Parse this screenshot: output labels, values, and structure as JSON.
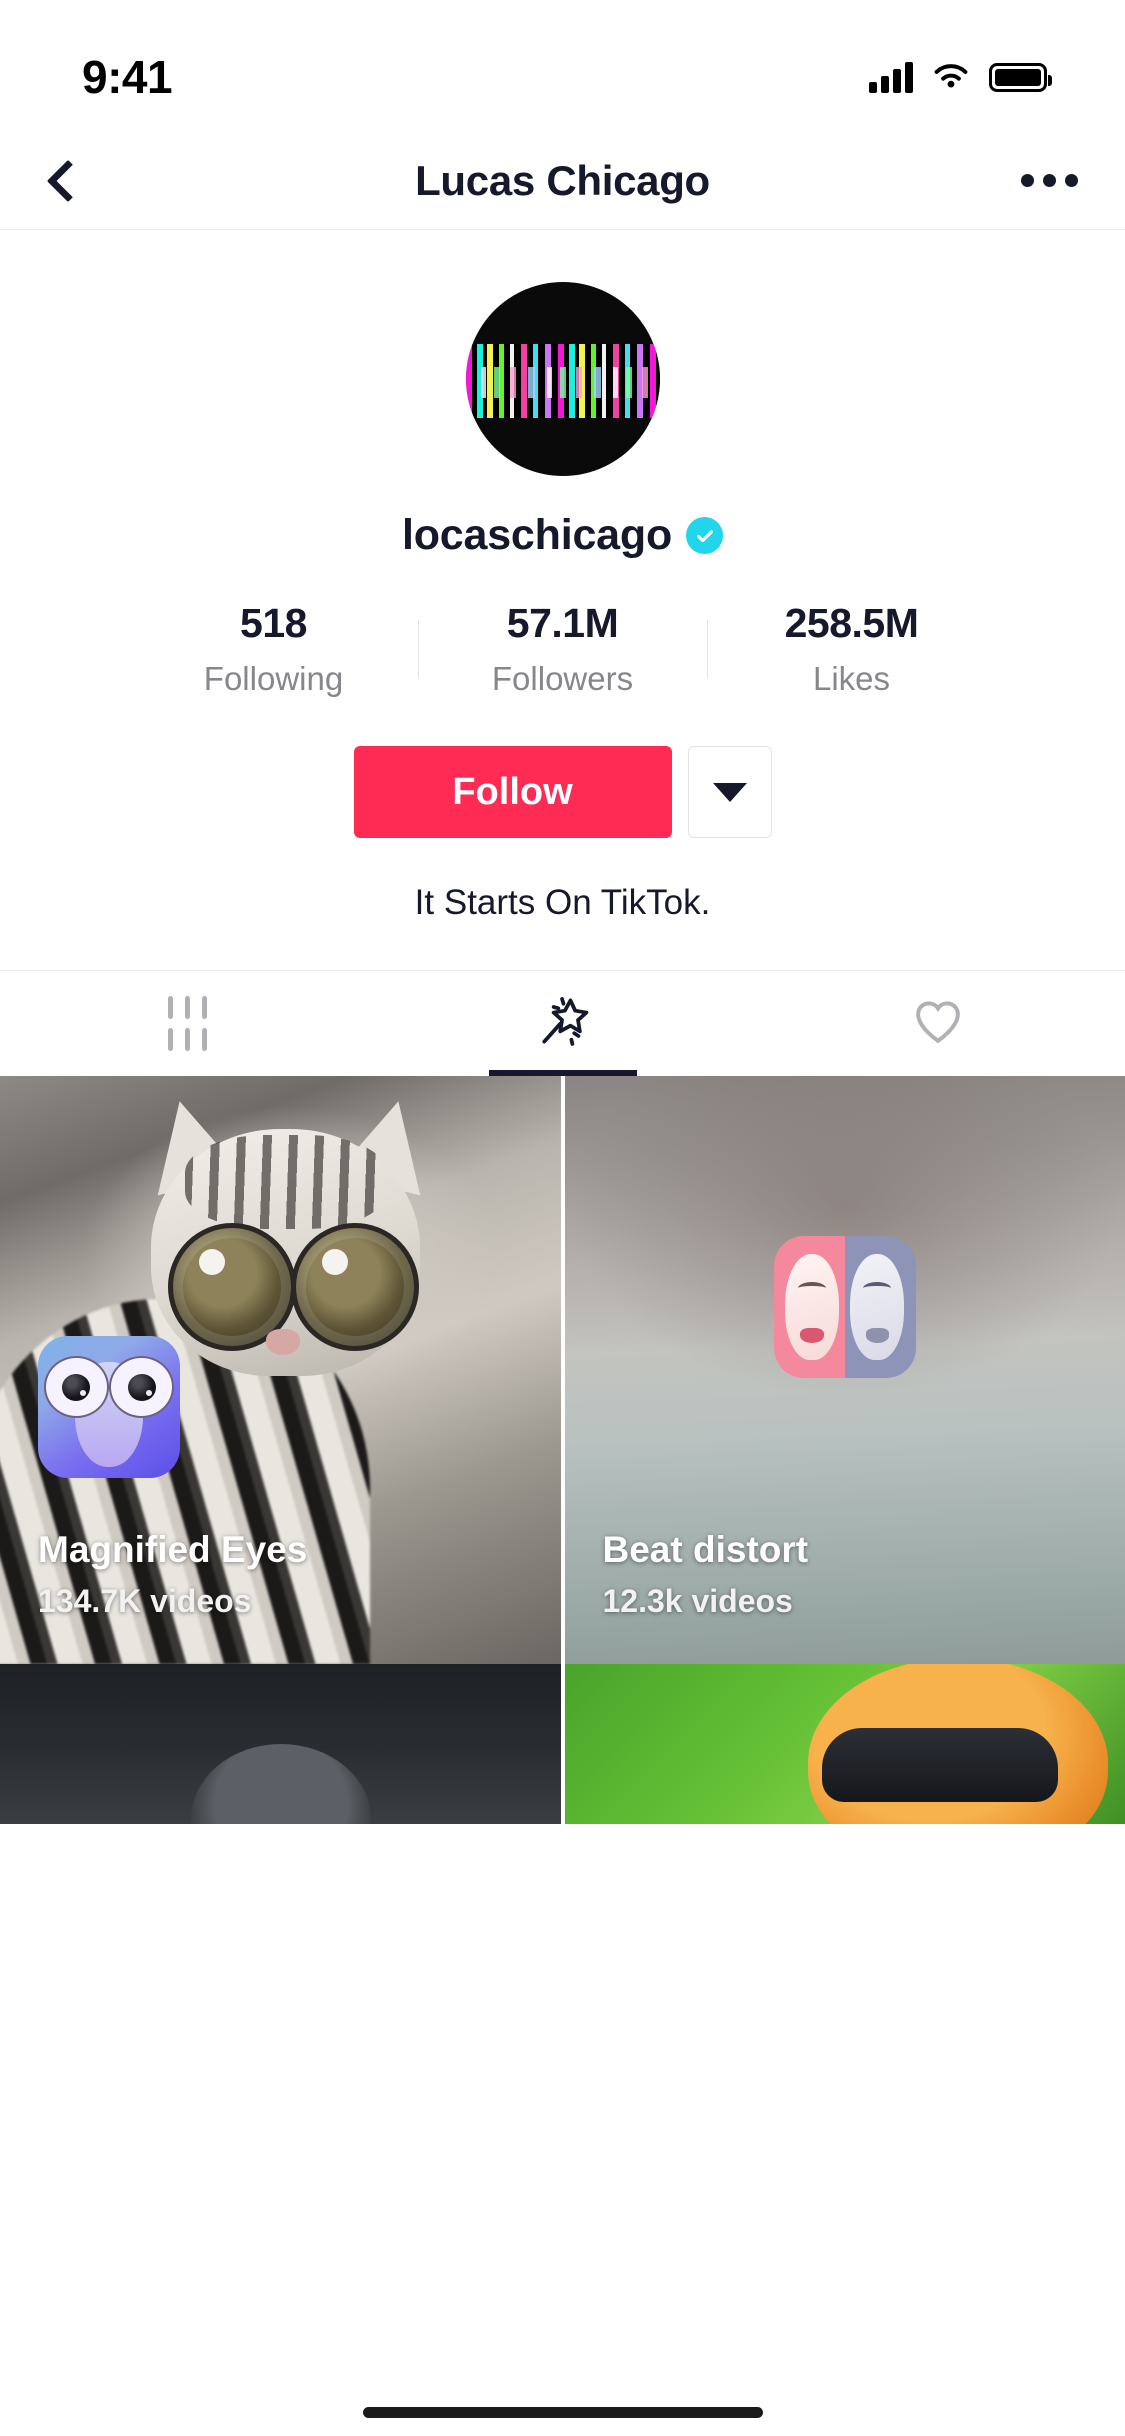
{
  "status_bar": {
    "time": "9:41",
    "cellular_icon": "signal-bars-icon",
    "wifi_icon": "wifi-icon",
    "battery_icon": "battery-icon"
  },
  "header": {
    "back_icon": "back-chevron-icon",
    "title": "Lucas Chicago",
    "more_icon": "more-options-icon"
  },
  "profile": {
    "avatar_icon": "avatar-image",
    "username": "locaschicago",
    "verified_icon": "verified-badge-icon",
    "verified_color": "#20D5EC",
    "bio": "It Starts On TikTok.",
    "stats": [
      {
        "value": "518",
        "label": "Following"
      },
      {
        "value": "57.1M",
        "label": "Followers"
      },
      {
        "value": "258.5M",
        "label": "Likes"
      }
    ],
    "follow_label": "Follow",
    "follow_color": "#FE2C55",
    "dropdown_icon": "chevron-down-icon"
  },
  "tabs": [
    {
      "icon": "grid-icon",
      "name": "videos",
      "active": false
    },
    {
      "icon": "magic-wand-icon",
      "name": "effects",
      "active": true
    },
    {
      "icon": "heart-icon",
      "name": "liked",
      "active": false
    }
  ],
  "effects": [
    {
      "title": "Magnified Eyes",
      "videos": "134.7K videos",
      "icon": "magnified-eyes-effect-icon"
    },
    {
      "title": "Beat distort",
      "videos": "12.3k videos",
      "icon": "beat-distort-effect-icon"
    }
  ]
}
